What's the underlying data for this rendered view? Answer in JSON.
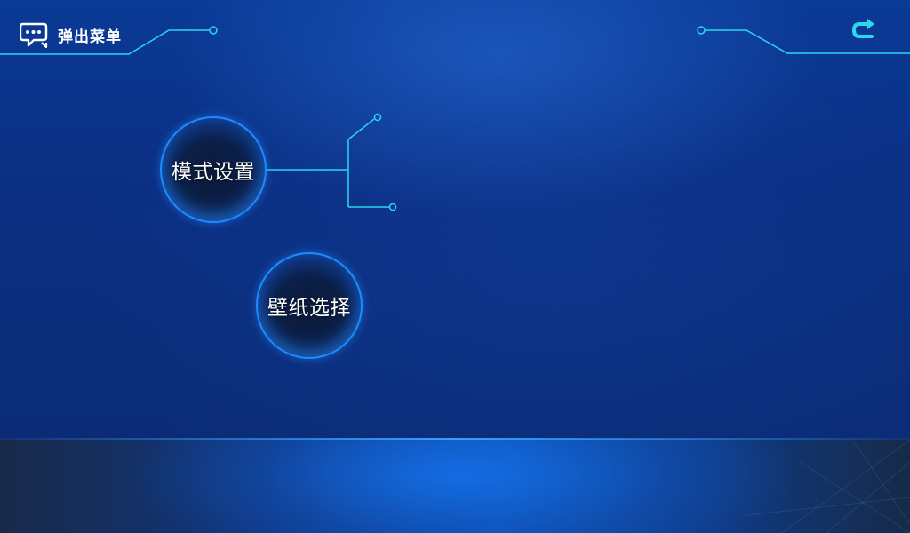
{
  "header": {
    "title": "弹出菜单",
    "menu_icon": "chat-bubbles-icon",
    "back_icon": "return-arrow-icon"
  },
  "menu": {
    "items": [
      {
        "label": "模式设置"
      },
      {
        "label": "壁纸选择"
      }
    ]
  },
  "colors": {
    "accent": "#2ad6f0",
    "circle_border": "#1c8cff",
    "background": "#0b2f82"
  }
}
